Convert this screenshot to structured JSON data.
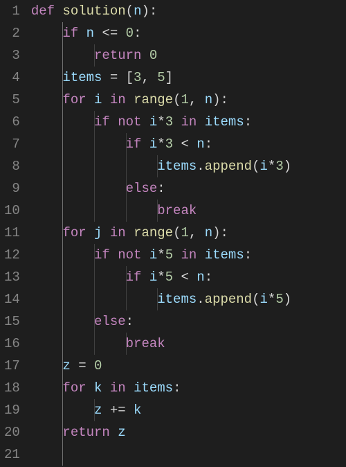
{
  "colors": {
    "background": "#1e1e1e",
    "gutter_fg": "#858585",
    "keyword": "#c586c0",
    "function": "#dcdcaa",
    "variable": "#9cdcfe",
    "number": "#b5cea8",
    "punctuation": "#d4d4d4",
    "indent_guide": "#404040",
    "indent_guide_active": "#707070"
  },
  "indent_width": 4,
  "line_numbers": [
    "1",
    "2",
    "3",
    "4",
    "5",
    "6",
    "7",
    "8",
    "9",
    "10",
    "11",
    "12",
    "13",
    "14",
    "15",
    "16",
    "17",
    "18",
    "19",
    "20",
    "21"
  ],
  "lines": [
    {
      "indent": 0,
      "tokens": [
        [
          "kw",
          "def"
        ],
        [
          "op",
          " "
        ],
        [
          "fn",
          "solution"
        ],
        [
          "paren",
          "("
        ],
        [
          "param",
          "n"
        ],
        [
          "paren",
          ")"
        ],
        [
          "op",
          ":"
        ]
      ]
    },
    {
      "indent": 1,
      "tokens": [
        [
          "kw",
          "if"
        ],
        [
          "op",
          " "
        ],
        [
          "param",
          "n"
        ],
        [
          "op",
          " <= "
        ],
        [
          "num",
          "0"
        ],
        [
          "op",
          ":"
        ]
      ]
    },
    {
      "indent": 2,
      "tokens": [
        [
          "kw",
          "return"
        ],
        [
          "op",
          " "
        ],
        [
          "num",
          "0"
        ]
      ]
    },
    {
      "indent": 1,
      "tokens": [
        [
          "param",
          "items"
        ],
        [
          "op",
          " = ["
        ],
        [
          "num",
          "3"
        ],
        [
          "op",
          ", "
        ],
        [
          "num",
          "5"
        ],
        [
          "op",
          "]"
        ]
      ]
    },
    {
      "indent": 1,
      "tokens": [
        [
          "kw",
          "for"
        ],
        [
          "op",
          " "
        ],
        [
          "param",
          "i"
        ],
        [
          "op",
          " "
        ],
        [
          "kw",
          "in"
        ],
        [
          "op",
          " "
        ],
        [
          "fn",
          "range"
        ],
        [
          "paren",
          "("
        ],
        [
          "num",
          "1"
        ],
        [
          "op",
          ", "
        ],
        [
          "param",
          "n"
        ],
        [
          "paren",
          ")"
        ],
        [
          "op",
          ":"
        ]
      ]
    },
    {
      "indent": 2,
      "tokens": [
        [
          "kw",
          "if"
        ],
        [
          "op",
          " "
        ],
        [
          "kw",
          "not"
        ],
        [
          "op",
          " "
        ],
        [
          "param",
          "i"
        ],
        [
          "op",
          "*"
        ],
        [
          "num",
          "3"
        ],
        [
          "op",
          " "
        ],
        [
          "kw",
          "in"
        ],
        [
          "op",
          " "
        ],
        [
          "param",
          "items"
        ],
        [
          "op",
          ":"
        ]
      ]
    },
    {
      "indent": 3,
      "tokens": [
        [
          "kw",
          "if"
        ],
        [
          "op",
          " "
        ],
        [
          "param",
          "i"
        ],
        [
          "op",
          "*"
        ],
        [
          "num",
          "3"
        ],
        [
          "op",
          " < "
        ],
        [
          "param",
          "n"
        ],
        [
          "op",
          ":"
        ]
      ]
    },
    {
      "indent": 4,
      "tokens": [
        [
          "param",
          "items"
        ],
        [
          "op",
          "."
        ],
        [
          "fn",
          "append"
        ],
        [
          "paren",
          "("
        ],
        [
          "param",
          "i"
        ],
        [
          "op",
          "*"
        ],
        [
          "num",
          "3"
        ],
        [
          "paren",
          ")"
        ]
      ]
    },
    {
      "indent": 3,
      "tokens": [
        [
          "kw",
          "else"
        ],
        [
          "op",
          ":"
        ]
      ]
    },
    {
      "indent": 4,
      "tokens": [
        [
          "kw",
          "break"
        ]
      ]
    },
    {
      "indent": 1,
      "tokens": [
        [
          "kw",
          "for"
        ],
        [
          "op",
          " "
        ],
        [
          "param",
          "j"
        ],
        [
          "op",
          " "
        ],
        [
          "kw",
          "in"
        ],
        [
          "op",
          " "
        ],
        [
          "fn",
          "range"
        ],
        [
          "paren",
          "("
        ],
        [
          "num",
          "1"
        ],
        [
          "op",
          ", "
        ],
        [
          "param",
          "n"
        ],
        [
          "paren",
          ")"
        ],
        [
          "op",
          ":"
        ]
      ]
    },
    {
      "indent": 2,
      "tokens": [
        [
          "kw",
          "if"
        ],
        [
          "op",
          " "
        ],
        [
          "kw",
          "not"
        ],
        [
          "op",
          " "
        ],
        [
          "param",
          "i"
        ],
        [
          "op",
          "*"
        ],
        [
          "num",
          "5"
        ],
        [
          "op",
          " "
        ],
        [
          "kw",
          "in"
        ],
        [
          "op",
          " "
        ],
        [
          "param",
          "items"
        ],
        [
          "op",
          ":"
        ]
      ]
    },
    {
      "indent": 3,
      "tokens": [
        [
          "kw",
          "if"
        ],
        [
          "op",
          " "
        ],
        [
          "param",
          "i"
        ],
        [
          "op",
          "*"
        ],
        [
          "num",
          "5"
        ],
        [
          "op",
          " < "
        ],
        [
          "param",
          "n"
        ],
        [
          "op",
          ":"
        ]
      ]
    },
    {
      "indent": 4,
      "tokens": [
        [
          "param",
          "items"
        ],
        [
          "op",
          "."
        ],
        [
          "fn",
          "append"
        ],
        [
          "paren",
          "("
        ],
        [
          "param",
          "i"
        ],
        [
          "op",
          "*"
        ],
        [
          "num",
          "5"
        ],
        [
          "paren",
          ")"
        ]
      ]
    },
    {
      "indent": 2,
      "tokens": [
        [
          "kw",
          "else"
        ],
        [
          "op",
          ":"
        ]
      ]
    },
    {
      "indent": 3,
      "tokens": [
        [
          "kw",
          "break"
        ]
      ]
    },
    {
      "indent": 1,
      "tokens": [
        [
          "param",
          "z"
        ],
        [
          "op",
          " = "
        ],
        [
          "num",
          "0"
        ]
      ]
    },
    {
      "indent": 1,
      "tokens": [
        [
          "kw",
          "for"
        ],
        [
          "op",
          " "
        ],
        [
          "param",
          "k"
        ],
        [
          "op",
          " "
        ],
        [
          "kw",
          "in"
        ],
        [
          "op",
          " "
        ],
        [
          "param",
          "items"
        ],
        [
          "op",
          ":"
        ]
      ]
    },
    {
      "indent": 2,
      "tokens": [
        [
          "param",
          "z"
        ],
        [
          "op",
          " += "
        ],
        [
          "param",
          "k"
        ]
      ]
    },
    {
      "indent": 1,
      "tokens": [
        [
          "kw",
          "return"
        ],
        [
          "op",
          " "
        ],
        [
          "param",
          "z"
        ]
      ]
    },
    {
      "indent": 1,
      "tokens": []
    }
  ]
}
